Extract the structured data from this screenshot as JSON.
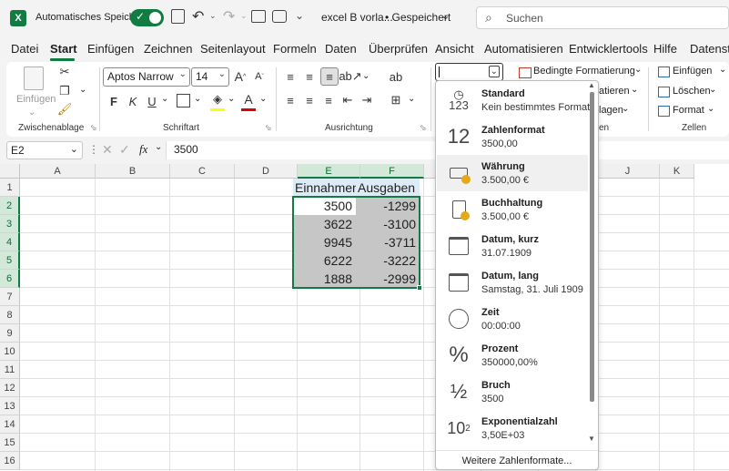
{
  "titlebar": {
    "autosave_label": "Automatisches Speichern",
    "file_name": "excel B vorla...",
    "save_status": "• Gespeichert",
    "search_placeholder": "Suchen"
  },
  "menu": {
    "items": [
      "Datei",
      "Start",
      "Einfügen",
      "Zeichnen",
      "Seitenlayout",
      "Formeln",
      "Daten",
      "Überprüfen",
      "Ansicht",
      "Automatisieren",
      "Entwicklertools",
      "Hilfe",
      "Datenstr"
    ],
    "active": "Start"
  },
  "ribbon": {
    "clipboard": {
      "paste_label": "Einfügen",
      "group_label": "Zwischenablage"
    },
    "font": {
      "font_name": "Aptos Narrow",
      "font_size": "14",
      "bold": "F",
      "italic": "K",
      "underline": "U",
      "font_color_letter": "A",
      "group_label": "Schriftart"
    },
    "alignment": {
      "group_label": "Ausrichtung"
    },
    "number": {
      "format_value": ""
    },
    "styles": {
      "conditional_formatting": "Bedingte Formatierung",
      "format_as_table_partial": "atieren",
      "cell_styles_partial": "lagen",
      "group_label_partial": "en"
    },
    "cells": {
      "insert": "Einfügen",
      "delete": "Löschen",
      "format": "Format",
      "group_label": "Zellen"
    }
  },
  "formula_bar": {
    "name_box": "E2",
    "fx": "fx",
    "content": "3500"
  },
  "grid": {
    "columns": [
      "A",
      "B",
      "C",
      "D",
      "E",
      "F",
      "G",
      "H",
      "I",
      "J",
      "K"
    ],
    "rows": [
      "1",
      "2",
      "3",
      "4",
      "5",
      "6",
      "7",
      "8",
      "9",
      "10",
      "11",
      "12",
      "13",
      "14",
      "15",
      "16"
    ],
    "headers": {
      "E1": "Einnahmen",
      "F1": "Ausgaben"
    },
    "income": [
      "3500",
      "3622",
      "9945",
      "6222",
      "1888"
    ],
    "expenses": [
      "-1299",
      "-3100",
      "-3711",
      "-3222",
      "-2999"
    ]
  },
  "number_format_menu": {
    "items": [
      {
        "name": "Standard",
        "sample": "Kein bestimmtes Format",
        "icon": "clock-123-icon"
      },
      {
        "name": "Zahlenformat",
        "sample": "3500,00",
        "icon": "number-12-icon"
      },
      {
        "name": "Währung",
        "sample": "3.500,00 €",
        "icon": "currency-icon"
      },
      {
        "name": "Buchhaltung",
        "sample": " 3.500,00 €",
        "icon": "accounting-icon"
      },
      {
        "name": "Datum, kurz",
        "sample": "31.07.1909",
        "icon": "calendar-short-icon"
      },
      {
        "name": "Datum, lang",
        "sample": "Samstag, 31. Juli 1909",
        "icon": "calendar-long-icon"
      },
      {
        "name": "Zeit",
        "sample": "00:00:00",
        "icon": "clock-icon"
      },
      {
        "name": "Prozent",
        "sample": "350000,00%",
        "icon": "percent-icon"
      },
      {
        "name": "Bruch",
        "sample": "3500",
        "icon": "fraction-icon"
      },
      {
        "name": "Exponentialzahl",
        "sample": "3,50E+03",
        "icon": "exponent-icon"
      }
    ],
    "more_formats": "Weitere Zahlenformate..."
  },
  "colors": {
    "accent": "#107c41",
    "selection_fill": "#c6c6c6",
    "header_fill": "#ddebf7",
    "font_color_bar": "#e00000"
  }
}
